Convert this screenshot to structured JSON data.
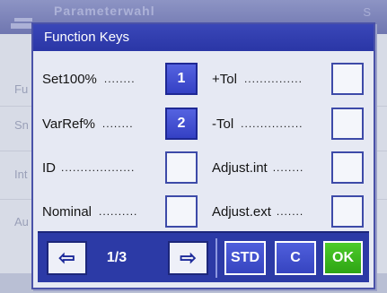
{
  "background": {
    "title": "Parameterwahl",
    "title_right": "S",
    "rows": [
      "Fu",
      "Sn",
      "Int",
      "Au"
    ]
  },
  "dialog": {
    "title": "Function Keys"
  },
  "left_column": [
    {
      "label": "Set100%",
      "dots": "........",
      "key": "1",
      "assigned": true
    },
    {
      "label": "VarRef%",
      "dots": "........",
      "key": "2",
      "assigned": true
    },
    {
      "label": "ID",
      "dots": "...................",
      "key": "",
      "assigned": false
    },
    {
      "label": "Nominal",
      "dots": "..........",
      "key": "",
      "assigned": false
    }
  ],
  "right_column": [
    {
      "label": "+Tol",
      "dots": "...............",
      "key": "",
      "assigned": false
    },
    {
      "label": "-Tol",
      "dots": "................",
      "key": "",
      "assigned": false
    },
    {
      "label": "Adjust.int",
      "dots": "........",
      "key": "",
      "assigned": false
    },
    {
      "label": "Adjust.ext",
      "dots": ".......",
      "key": "",
      "assigned": false
    }
  ],
  "footer": {
    "prev_icon": "arrow-left-icon",
    "prev_glyph": "⇦",
    "page": "1/3",
    "next_icon": "arrow-right-icon",
    "next_glyph": "⇨",
    "std_label": "STD",
    "c_label": "C",
    "ok_label": "OK"
  },
  "colors": {
    "title_bar": "#2a36a6",
    "assigned_key": "#3d4ac8",
    "ok_button": "#34ad18",
    "footer": "#2c3aa6"
  }
}
